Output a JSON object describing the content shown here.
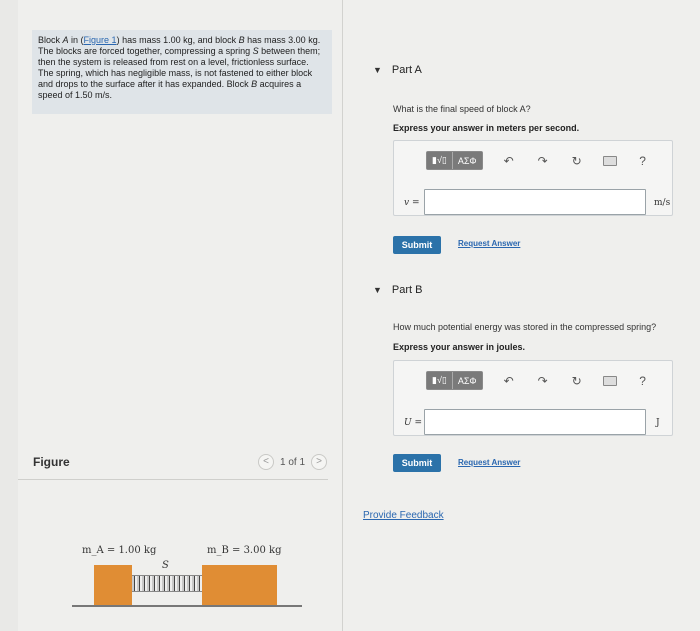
{
  "problem": {
    "p1": "Block ",
    "var_a": "A",
    "p2": " in (",
    "link": "Figure 1",
    "p3": ") has mass 1.00 kg, and block ",
    "var_b": "B",
    "p4": " has mass 3.00 kg. The blocks are forced together, compressing a spring ",
    "var_s": "S",
    "p5": " between them; then the system is released from rest on a level, frictionless surface. The spring, which has negligible mass, is not fastened to either block and drops to the surface after it has expanded. Block ",
    "var_b2": "B",
    "p6": " acquires a speed of 1.50 m/s."
  },
  "figure": {
    "title": "Figure",
    "pager_text": "1 of 1",
    "prev": "<",
    "next": ">",
    "ma_label": "m_A = 1.00 kg",
    "mb_label": "m_B = 3.00 kg",
    "spring_label": "S",
    "block_color": "#e08d34"
  },
  "parts": [
    {
      "title": "Part A",
      "question": "What is the final speed of block A?",
      "instruction": "Express your answer in meters per second.",
      "var": "v =",
      "unit": "m/s",
      "value": "",
      "submit": "Submit",
      "request": "Request Answer"
    },
    {
      "title": "Part B",
      "question": "How much potential energy was stored in the compressed spring?",
      "instruction": "Express your answer in joules.",
      "var": "U =",
      "unit": "J",
      "value": "",
      "submit": "Submit",
      "request": "Request Answer"
    }
  ],
  "toolbar": {
    "templates": "▮√▯",
    "symbols": "ΑΣΦ",
    "help": "?"
  },
  "feedback": "Provide Feedback",
  "colors": {
    "accent": "#2b72a9",
    "link": "#2a67b0"
  }
}
